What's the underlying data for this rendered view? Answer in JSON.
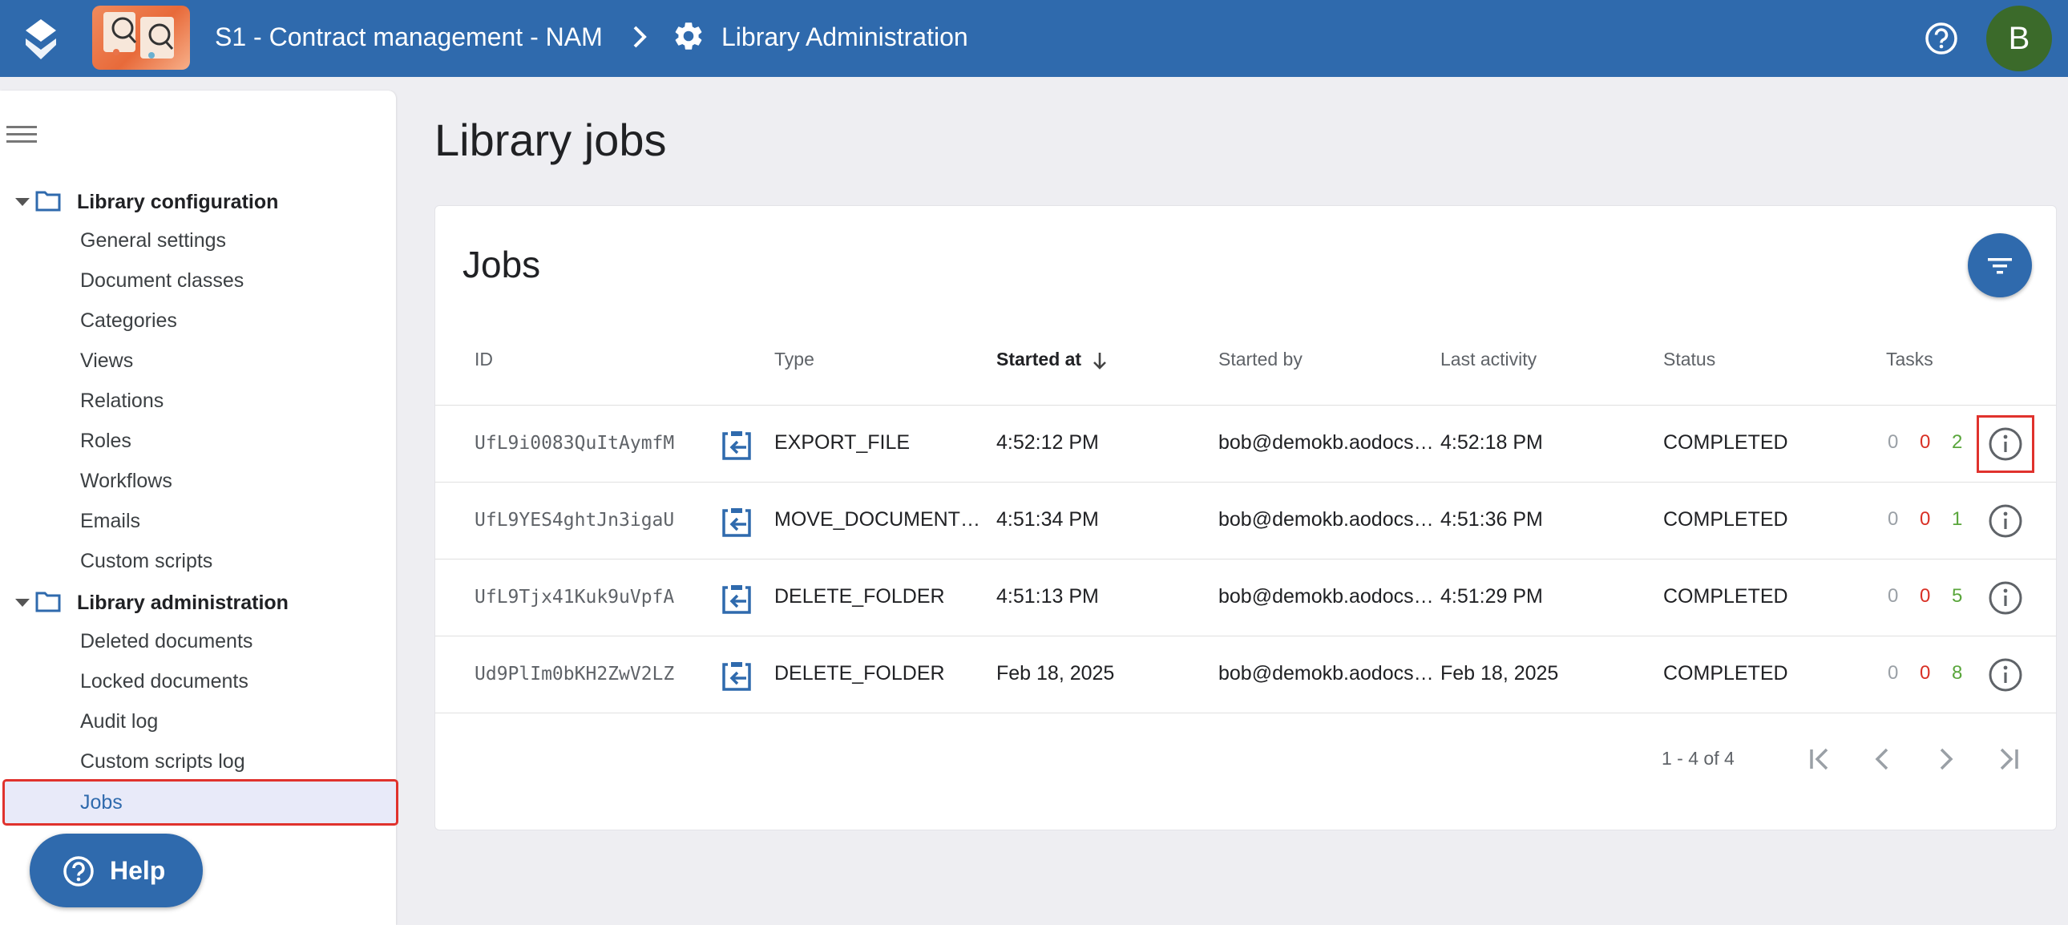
{
  "header": {
    "library_name": "S1 - Contract management - NAM",
    "page_name": "Library Administration",
    "avatar_initial": "B",
    "help_icon": "help-circle-icon",
    "accent_color": "#2f6aad"
  },
  "sidebar": {
    "groups": [
      {
        "label": "Library configuration",
        "items": [
          "General settings",
          "Document classes",
          "Categories",
          "Views",
          "Relations",
          "Roles",
          "Workflows",
          "Emails",
          "Custom scripts"
        ]
      },
      {
        "label": "Library administration",
        "items": [
          "Deleted documents",
          "Locked documents",
          "Audit log",
          "Custom scripts log",
          "Jobs"
        ]
      }
    ],
    "active_item": "Jobs",
    "help_label": "Help"
  },
  "main": {
    "title": "Library jobs",
    "card_title": "Jobs",
    "columns": {
      "id": "ID",
      "type": "Type",
      "started_at": "Started at",
      "started_by": "Started by",
      "last_activity": "Last activity",
      "status": "Status",
      "tasks": "Tasks"
    },
    "rows": [
      {
        "id": "UfL9i0083QuItAymfM",
        "type": "EXPORT_FILE",
        "started_at": "4:52:12 PM",
        "started_by": "bob@demokb.aodocs.com",
        "last_activity": "4:52:18 PM",
        "status": "COMPLETED",
        "tasks": [
          "0",
          "0",
          "2"
        ]
      },
      {
        "id": "UfL9YES4ghtJn3igaU",
        "type": "MOVE_DOCUMENTS_TO_FOLDER",
        "started_at": "4:51:34 PM",
        "started_by": "bob@demokb.aodocs.com",
        "last_activity": "4:51:36 PM",
        "status": "COMPLETED",
        "tasks": [
          "0",
          "0",
          "1"
        ]
      },
      {
        "id": "UfL9Tjx41Kuk9uVpfA",
        "type": "DELETE_FOLDER",
        "started_at": "4:51:13 PM",
        "started_by": "bob@demokb.aodocs.com",
        "last_activity": "4:51:29 PM",
        "status": "COMPLETED",
        "tasks": [
          "0",
          "0",
          "5"
        ]
      },
      {
        "id": "Ud9PlIm0bKH2ZwV2LZ",
        "type": "DELETE_FOLDER",
        "started_at": "Feb 18, 2025",
        "started_by": "bob@demokb.aodocs.com",
        "last_activity": "Feb 18, 2025",
        "status": "COMPLETED",
        "tasks": [
          "0",
          "0",
          "8"
        ]
      }
    ],
    "pagination": "1 - 4 of 4"
  }
}
